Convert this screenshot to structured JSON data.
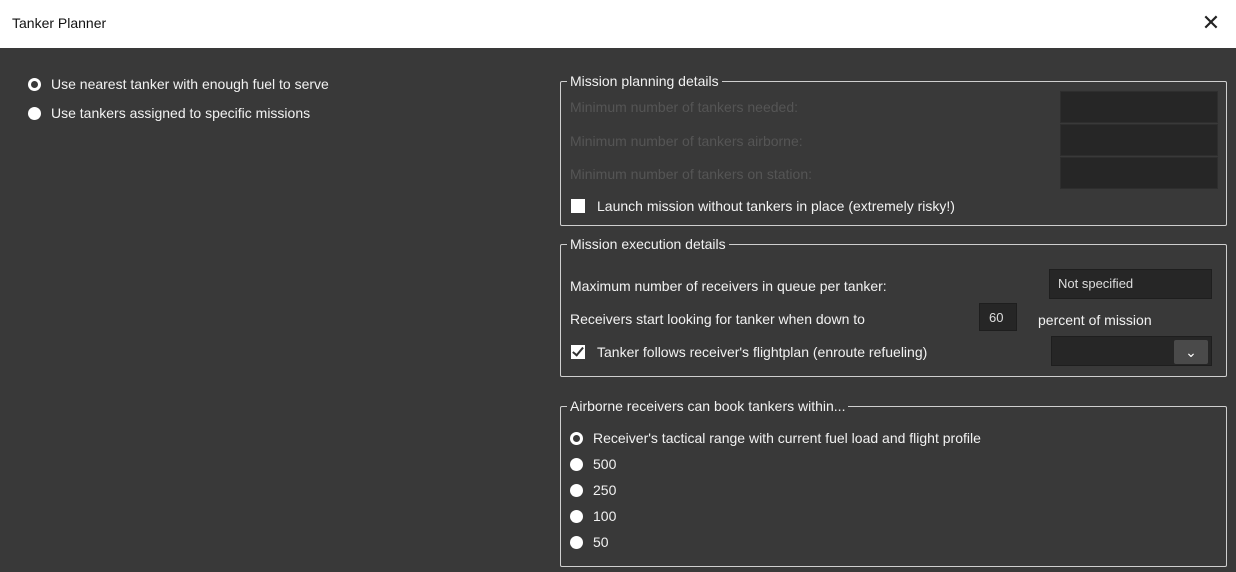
{
  "window": {
    "title": "Tanker Planner",
    "close_glyph": "✕"
  },
  "tanker_selection": {
    "options": [
      {
        "label": "Use nearest tanker with enough fuel to serve",
        "selected": true
      },
      {
        "label": "Use tankers assigned to specific missions",
        "selected": false
      }
    ]
  },
  "mission_planning": {
    "legend": "Mission planning details",
    "rows": [
      {
        "label": "Minimum number of tankers needed:",
        "value": ""
      },
      {
        "label": "Minimum number of tankers airborne:",
        "value": ""
      },
      {
        "label": "Minimum number of tankers on station:",
        "value": ""
      }
    ],
    "launch_checkbox": {
      "label": "Launch mission without tankers in place (extremely risky!)",
      "checked": false
    }
  },
  "mission_execution": {
    "legend": "Mission execution details",
    "max_receivers_label": "Maximum number of receivers in queue per tanker:",
    "max_receivers_value": "Not specified",
    "receivers_start_prefix": "Receivers start looking for tanker when down to",
    "receivers_start_value": "60",
    "receivers_start_suffix": "percent of mission",
    "follow_flightplan": {
      "label": "Tanker follows receiver's flightplan (enroute refueling)",
      "checked": true
    },
    "dropdown_icon": "chevron-down-icon"
  },
  "airborne_booking": {
    "legend": "Airborne receivers can book tankers within...",
    "options": [
      {
        "label": "Receiver's tactical range with current fuel load and flight profile",
        "selected": true
      },
      {
        "label": "500",
        "selected": false
      },
      {
        "label": "250",
        "selected": false
      },
      {
        "label": "100",
        "selected": false
      },
      {
        "label": "50",
        "selected": false
      }
    ]
  }
}
